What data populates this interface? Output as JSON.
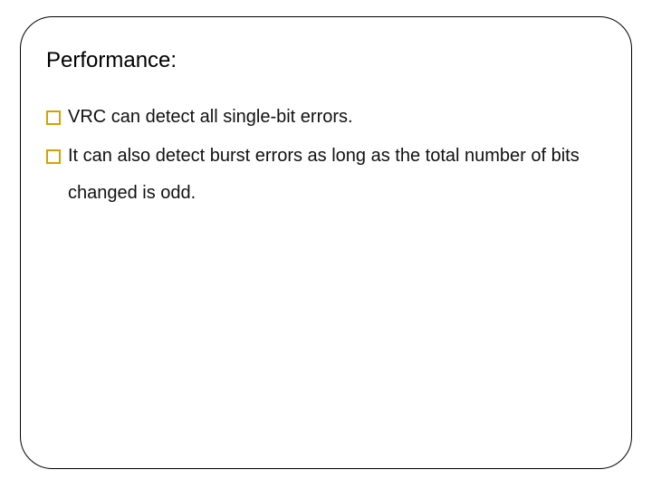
{
  "slide": {
    "heading": "Performance:",
    "bullets": [
      {
        "text": "VRC can detect all single-bit errors."
      },
      {
        "text": "It can also detect burst errors as long as the total number of bits changed is odd."
      }
    ]
  }
}
